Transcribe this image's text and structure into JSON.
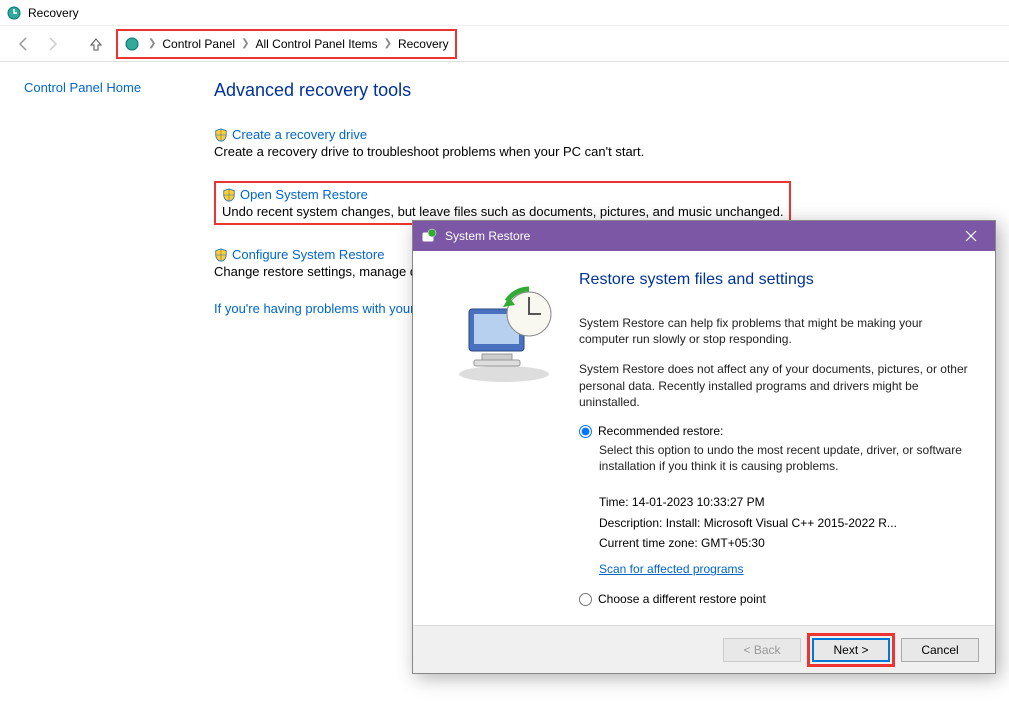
{
  "window": {
    "title": "Recovery"
  },
  "breadcrumb": {
    "items": [
      "Control Panel",
      "All Control Panel Items",
      "Recovery"
    ]
  },
  "sidebar": {
    "home_link": "Control Panel Home"
  },
  "content": {
    "heading": "Advanced recovery tools",
    "tools": [
      {
        "link": "Create a recovery drive",
        "desc": "Create a recovery drive to troubleshoot problems when your PC can't start."
      },
      {
        "link": "Open System Restore",
        "desc": "Undo recent system changes, but leave files such as documents, pictures, and music unchanged."
      },
      {
        "link": "Configure System Restore",
        "desc": "Change restore settings, manage dis"
      }
    ],
    "troubleshoot": "If you're having problems with your"
  },
  "dialog": {
    "title": "System Restore",
    "heading": "Restore system files and settings",
    "para1": "System Restore can help fix problems that might be making your computer run slowly or stop responding.",
    "para2": "System Restore does not affect any of your documents, pictures, or other personal data. Recently installed programs and drivers might be uninstalled.",
    "radio1": "Recommended restore:",
    "radio1_desc": "Select this option to undo the most recent update, driver, or software installation if you think it is causing problems.",
    "info": {
      "time_label": "Time: ",
      "time": "14-01-2023 10:33:27 PM",
      "desc_label": "Description: ",
      "desc": "Install: Microsoft Visual C++ 2015-2022 R...",
      "tz_label": "Current time zone: ",
      "tz": "GMT+05:30",
      "scan_link": "Scan for affected programs"
    },
    "radio2": "Choose a different restore point",
    "buttons": {
      "back": "< Back",
      "next": "Next >",
      "cancel": "Cancel"
    }
  }
}
